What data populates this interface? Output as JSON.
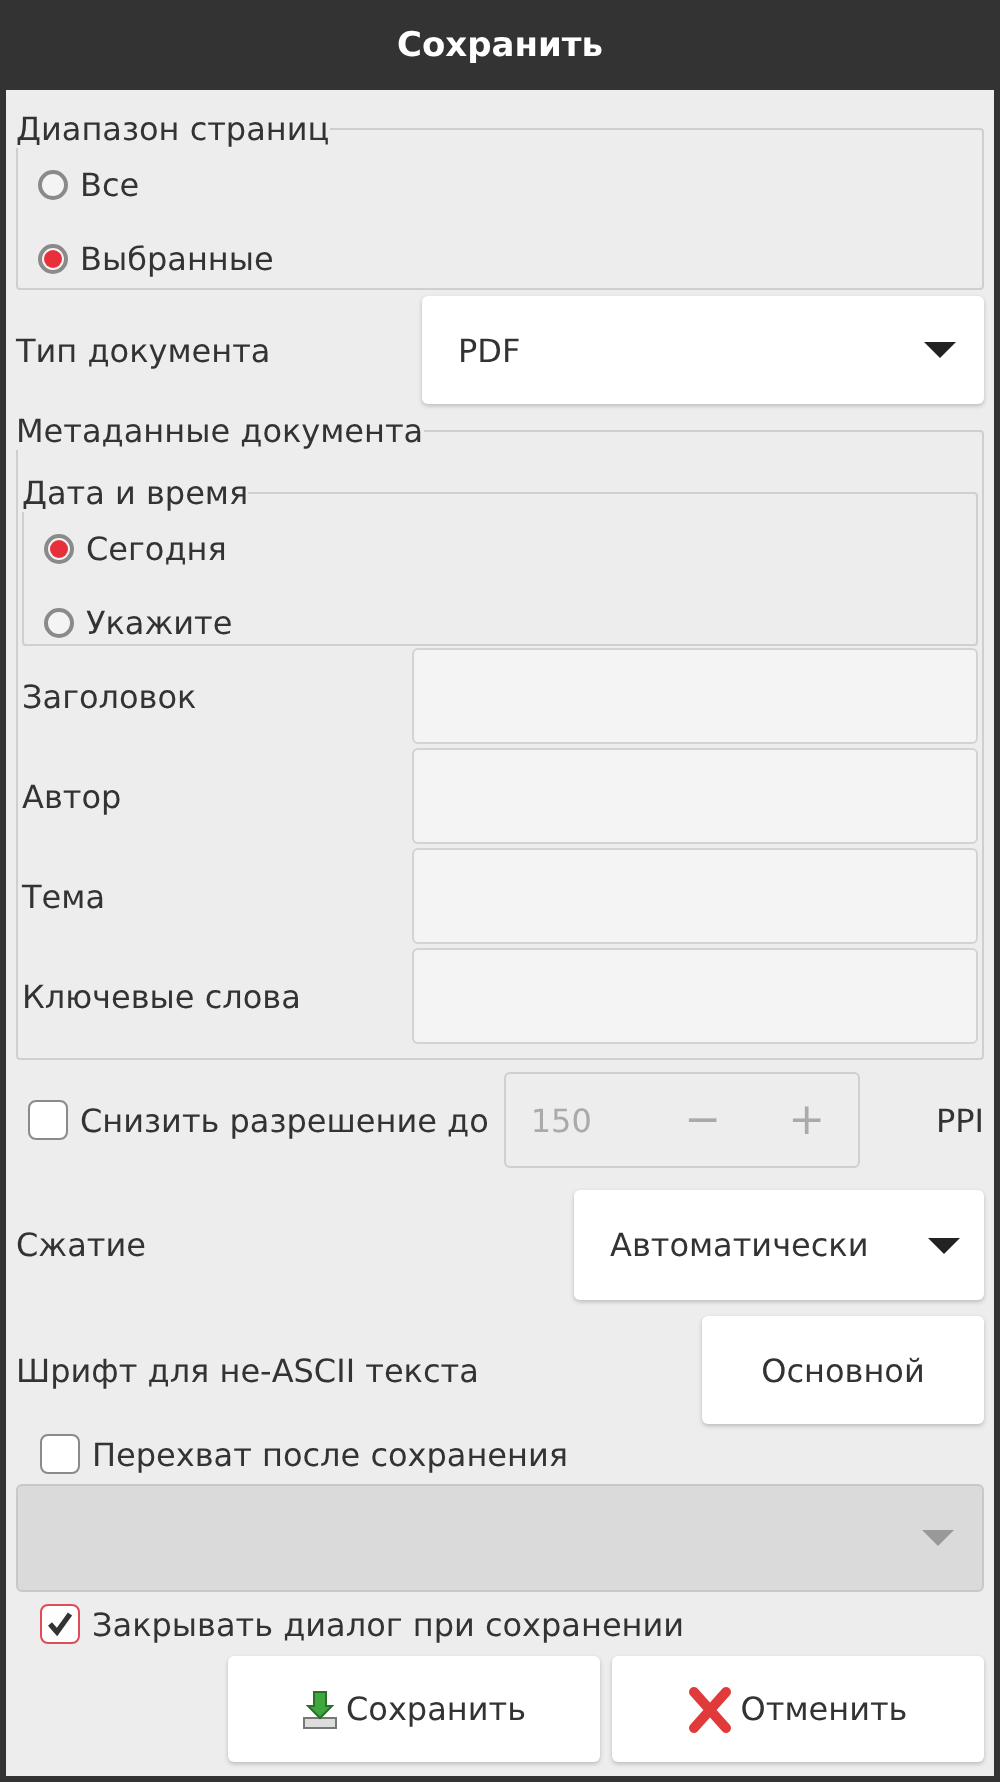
{
  "window": {
    "title": "Сохранить"
  },
  "page_range": {
    "label": "Диапазон страниц",
    "options": [
      {
        "label": "Все",
        "selected": false
      },
      {
        "label": "Выбранные",
        "selected": true
      }
    ]
  },
  "document_type": {
    "label": "Тип документа",
    "value": "PDF"
  },
  "metadata": {
    "label": "Метаданные документа",
    "date_time": {
      "label": "Дата и время",
      "options": [
        {
          "label": "Сегодня",
          "selected": true
        },
        {
          "label": "Укажите",
          "selected": false
        }
      ]
    },
    "fields": [
      {
        "label": "Заголовок"
      },
      {
        "label": "Автор"
      },
      {
        "label": "Тема"
      },
      {
        "label": "Ключевые слова"
      }
    ]
  },
  "downsample": {
    "label": "Снизить разрешение до",
    "checked": false,
    "value": "150",
    "decrement": "−",
    "increment": "+",
    "unit": "PPI",
    "disabled": true
  },
  "compression": {
    "label": "Сжатие",
    "value": "Автоматически"
  },
  "font": {
    "label": "Шрифт для не-ASCII текста",
    "button": "Основной"
  },
  "post_hook": {
    "label": "Перехват после сохранения",
    "checked": false,
    "command_disabled": true
  },
  "close_on_save": {
    "label": "Закрывать диалог при сохранении",
    "checked": true
  },
  "buttons": [
    {
      "label": "Сохранить",
      "kind": "save"
    },
    {
      "label": "Отменить",
      "kind": "cancel"
    }
  ]
}
